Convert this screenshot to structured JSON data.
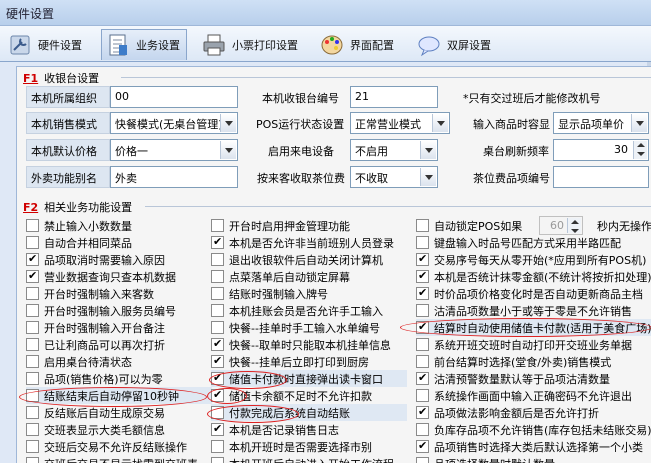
{
  "window": {
    "title": "硬件设置"
  },
  "tabs": [
    {
      "label": "硬件设置",
      "icon": "wrench-icon"
    },
    {
      "label": "业务设置",
      "icon": "document-icon",
      "active": true
    },
    {
      "label": "小票打印设置",
      "icon": "printer-icon"
    },
    {
      "label": "界面配置",
      "icon": "palette-icon"
    },
    {
      "label": "双屏设置",
      "icon": "chat-icon"
    }
  ],
  "section1": {
    "key": "F1",
    "title": "收银台设置"
  },
  "fields": {
    "org_label": "本机所属组织",
    "org_value": "00",
    "pos_no_label": "本机收银台编号",
    "pos_no_value": "21",
    "pos_note": "*只有交过班后才能修改机号",
    "sale_mode_label": "本机销售模式",
    "sale_mode_value": "快餐模式(无桌台管理)",
    "pos_state_label": "POS运行状态设置",
    "pos_state_value": "正常营业模式",
    "input_box_label": "输入商品时容显",
    "input_box_value": "显示品项单价",
    "price_label": "本机默认价格",
    "price_value": "价格一",
    "caller_label": "启用来电设备",
    "caller_value": "不启用",
    "refresh_label": "桌台刷新频率",
    "refresh_value": "30",
    "takeout_label": "外卖功能别名",
    "takeout_value": "外卖",
    "tea_fee_label": "按来客收取茶位费",
    "tea_fee_value": "不收取",
    "tea_item_label": "茶位费品项编号",
    "tea_item_value": ""
  },
  "section2": {
    "key": "F2",
    "title": "相关业务功能设置"
  },
  "auto_lock_spin": "60",
  "auto_lock_suffix": "秒内无操作",
  "col1": [
    {
      "label": "禁止输入小数数量",
      "checked": false
    },
    {
      "label": "自动合并相同菜品",
      "checked": false
    },
    {
      "label": "品项取消时需要输入原因",
      "checked": true
    },
    {
      "label": "营业数据查询只查本机数据",
      "checked": true
    },
    {
      "label": "开台时强制输入来客数",
      "checked": false
    },
    {
      "label": "开台时强制输入服务员编号",
      "checked": false
    },
    {
      "label": "开台时强制输入开台备注",
      "checked": false
    },
    {
      "label": "已让利商品可以再次打折",
      "checked": false
    },
    {
      "label": "启用桌台待清状态",
      "checked": false
    },
    {
      "label": "品项(销售价格)可以为零",
      "checked": false
    },
    {
      "label": "结账结束后自动停留10秒钟",
      "checked": false
    },
    {
      "label": "反结账后自动生成原交易",
      "checked": false
    },
    {
      "label": "交班表显示大类毛额信息",
      "checked": false
    },
    {
      "label": "交班后交易不允许反结账操作",
      "checked": false
    },
    {
      "label": "交班后交易不显示找零到交班表",
      "checked": false
    }
  ],
  "col2": [
    {
      "label": "开台时启用押金管理功能",
      "checked": false
    },
    {
      "label": "本机是否允许非当前班别人员登录",
      "checked": true
    },
    {
      "label": "退出收银软件后自动关闭计算机",
      "checked": false
    },
    {
      "label": "点菜落单后自动锁定屏幕",
      "checked": false
    },
    {
      "label": "结账时强制输入牌号",
      "checked": false
    },
    {
      "label": "本机挂账会员是否允许手工输入",
      "checked": false
    },
    {
      "label": "快餐--挂单时手工输入水单编号",
      "checked": false
    },
    {
      "label": "快餐--取单时只能取本机挂单信息",
      "checked": true
    },
    {
      "label": "快餐--挂单后立即打印到厨房",
      "checked": true
    },
    {
      "label": "储值卡付款时直接弹出读卡窗口",
      "checked": true
    },
    {
      "label": "储值卡余额不足时不允许扣款",
      "checked": true
    },
    {
      "label": "付款完成后系统自动结账",
      "checked": false
    },
    {
      "label": "本机是否记录销售日志",
      "checked": true
    },
    {
      "label": "本机开班时是否需要选择市别",
      "checked": false
    },
    {
      "label": "本机开班后自动进入开始工作流程",
      "checked": false
    }
  ],
  "col3": [
    {
      "label": "自动锁定POS如果",
      "checked": false
    },
    {
      "label": "键盘输入时品号匹配方式采用半路匹配",
      "checked": false
    },
    {
      "label": "交易序号每天从零开始(*应用到所有POS机)",
      "checked": true
    },
    {
      "label": "本机是否统计抹零金额(不统计将按折扣处理)",
      "checked": true
    },
    {
      "label": "时价品项价格变化时是否自动更新商品主档",
      "checked": true
    },
    {
      "label": "沽清品项数量小于或等于零是不允许销售",
      "checked": false
    },
    {
      "label": "结算时自动使用储值卡付款(适用于美食广场)",
      "checked": true
    },
    {
      "label": "系统开班交班时自动打印开交班业务单据",
      "checked": false
    },
    {
      "label": "前台结算时选择(堂食/外卖)销售模式",
      "checked": false
    },
    {
      "label": "沽清预警数量默认等于品项沽清数量",
      "checked": true
    },
    {
      "label": "系统操作画面中输入正确密码不允许退出",
      "checked": false
    },
    {
      "label": "品项做法影响金额后是否允许打折",
      "checked": true
    },
    {
      "label": "负库存品项不允许销售(库存包括未结账交易)",
      "checked": false
    },
    {
      "label": "品项销售时选择大类后默认选择第一个小类",
      "checked": true
    },
    {
      "label": "品项选择数量时默认数量",
      "checked": false
    }
  ]
}
